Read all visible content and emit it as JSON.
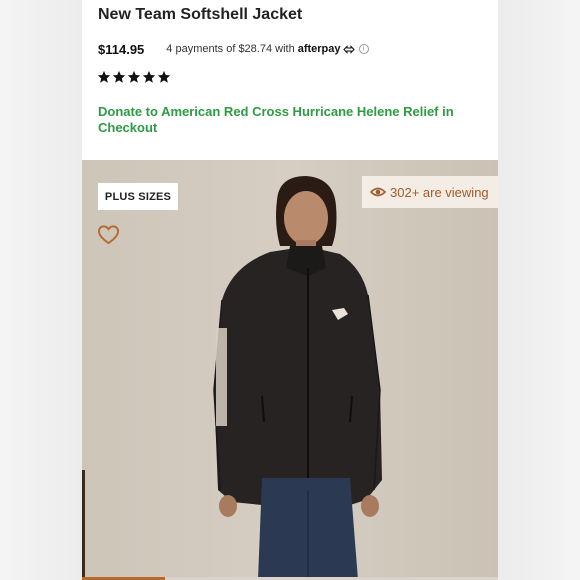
{
  "product": {
    "title": "New Team Softshell Jacket",
    "price": "$114.95",
    "installments": {
      "prefix": "4 payments of",
      "amount": "$28.74",
      "suffix": "with",
      "provider": "afterpay"
    },
    "rating": 5,
    "donate_text": "Donate to American Red Cross Hurricane Helene Relief in Checkout"
  },
  "gallery": {
    "badge": "PLUS SIZES",
    "viewing_text": "302+ are viewing",
    "image_index_fraction": 0.2
  },
  "colors": {
    "accent": "#b86a2d",
    "donate_green": "#2e9b43",
    "viewing_text": "#a55a26"
  },
  "icons": [
    "info-icon",
    "star-icon",
    "heart-icon",
    "eye-icon"
  ]
}
